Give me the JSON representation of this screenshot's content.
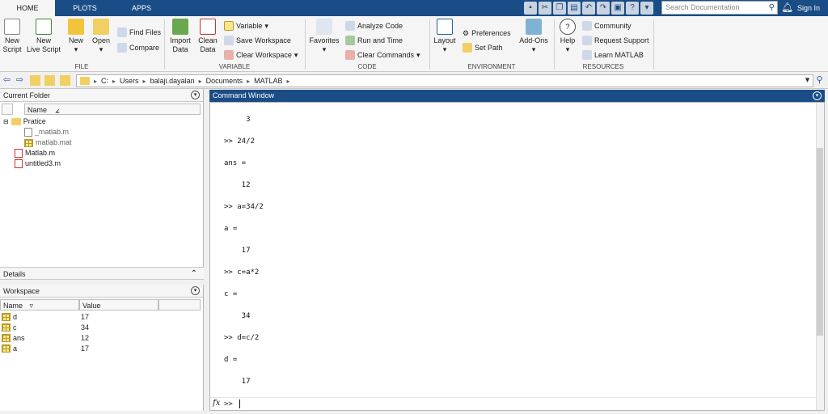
{
  "tabs": [
    {
      "label": "HOME"
    },
    {
      "label": "PLOTS"
    },
    {
      "label": "APPS"
    }
  ],
  "search": {
    "placeholder": "Search Documentation"
  },
  "signin_label": "Sign In",
  "ribbon": {
    "file": {
      "group": "FILE",
      "new_script": [
        "New",
        "Script"
      ],
      "new_live_script": [
        "New",
        "Live Script"
      ],
      "new": "New",
      "open": "Open",
      "find_files": "Find Files",
      "compare": "Compare"
    },
    "variable": {
      "group": "VARIABLE",
      "import_data": [
        "Import",
        "Data"
      ],
      "clean_data": [
        "Clean",
        "Data"
      ],
      "variable": "Variable",
      "save_workspace": "Save Workspace",
      "clear_workspace": "Clear Workspace"
    },
    "code": {
      "group": "CODE",
      "favorites": "Favorites",
      "analyze_code": "Analyze Code",
      "run_and_time": "Run and Time",
      "clear_commands": "Clear Commands"
    },
    "environment": {
      "group": "ENVIRONMENT",
      "layout": "Layout",
      "preferences": "Preferences",
      "set_path": "Set Path",
      "add_ons": "Add-Ons"
    },
    "resources": {
      "group": "RESOURCES",
      "help": "Help",
      "community": "Community",
      "request_support": "Request Support",
      "learn_matlab": "Learn MATLAB"
    }
  },
  "address": {
    "path": [
      "C:",
      "Users",
      "balaji.dayalan",
      "Documents",
      "MATLAB"
    ]
  },
  "current_folder": {
    "title": "Current Folder",
    "column": "Name",
    "items": [
      {
        "name": "Pratice"
      },
      {
        "name": "_matlab.m"
      },
      {
        "name": "matlab.mat"
      },
      {
        "name": "Matlab.m"
      },
      {
        "name": "untitled3.m"
      }
    ]
  },
  "details": {
    "title": "Details"
  },
  "workspace": {
    "title": "Workspace",
    "columns": [
      "Name",
      "Value"
    ],
    "rows": [
      {
        "name": "d",
        "value": "17"
      },
      {
        "name": "c",
        "value": "34"
      },
      {
        "name": "ans",
        "value": "12"
      },
      {
        "name": "a",
        "value": "17"
      }
    ]
  },
  "command_window": {
    "title": "Command Window",
    "lines": [
      "     3",
      ">> 24/2",
      "ans =",
      "    12",
      ">> a=34/2",
      "a =",
      "    17",
      ">> c=a*2",
      "c =",
      "    34",
      ">> d=c/2",
      "d =",
      "    17"
    ],
    "prompt": ">>",
    "fx": "fx"
  }
}
